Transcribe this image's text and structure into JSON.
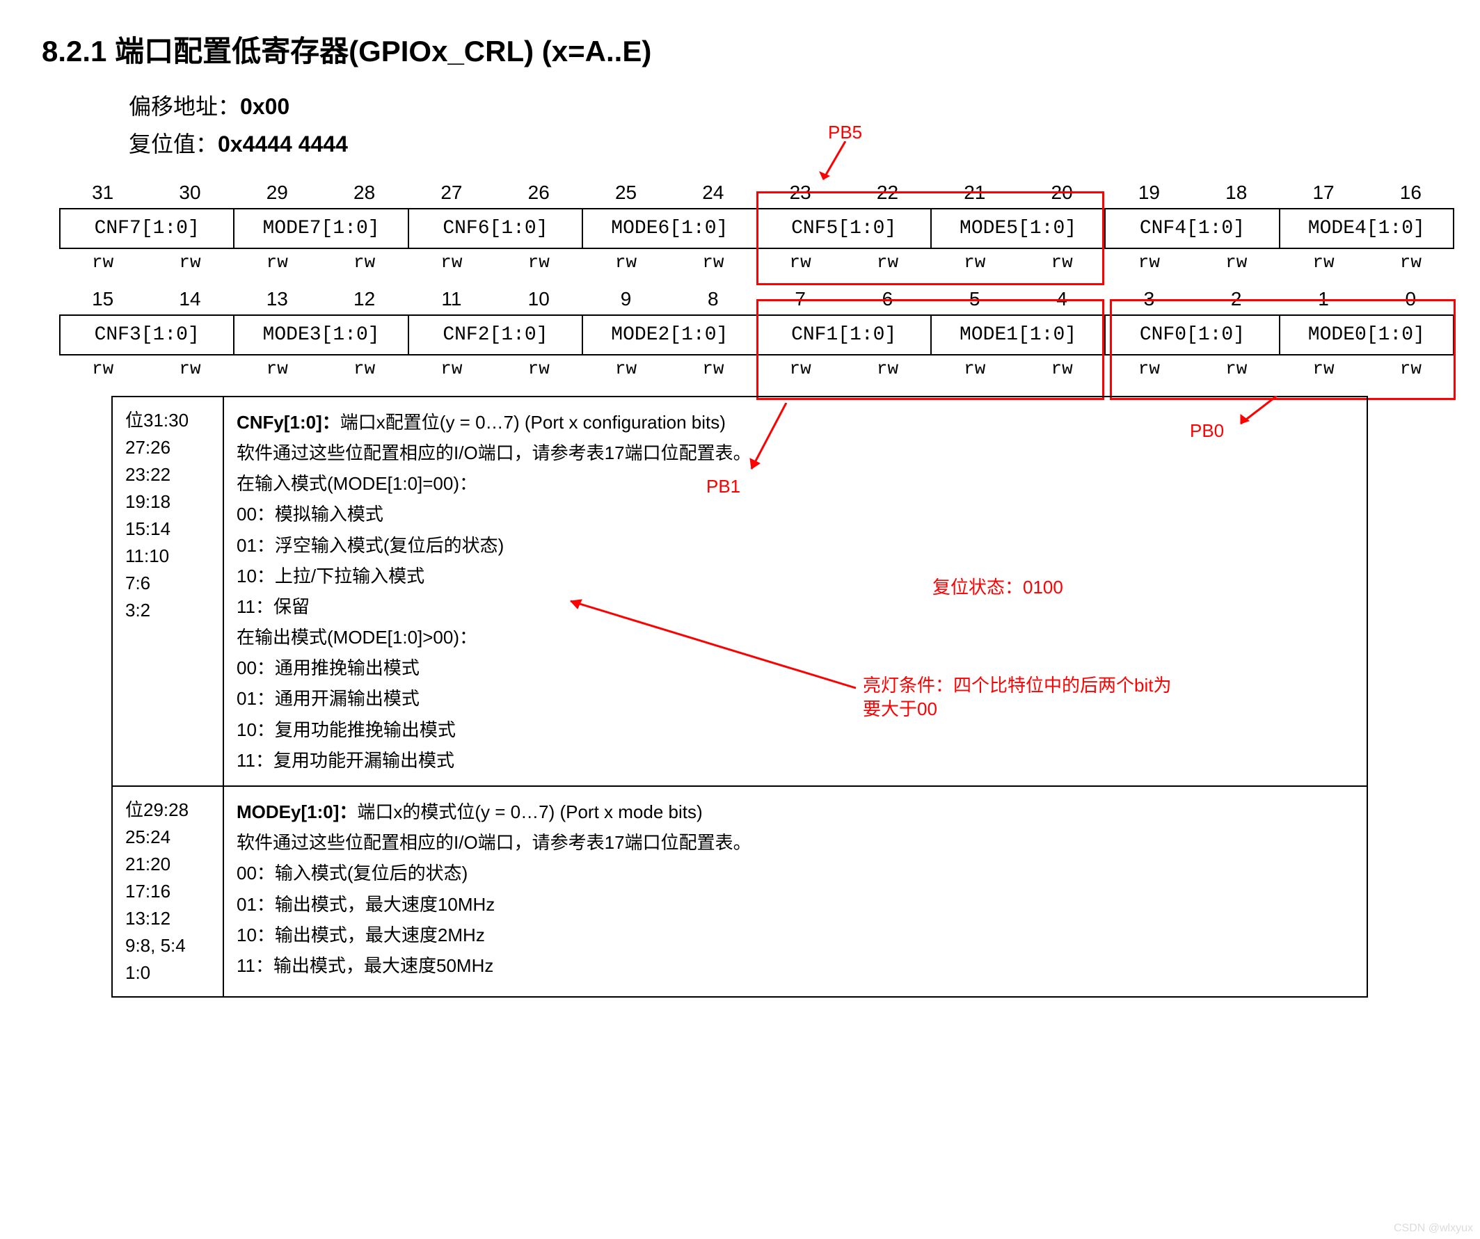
{
  "header": "8.2.1    端口配置低寄存器(GPIOx_CRL) (x=A..E)",
  "meta": {
    "offset_label": "偏移地址：",
    "offset_val": "0x00",
    "reset_label": "复位值：",
    "reset_val": "0x4444 4444"
  },
  "bits_high": [
    "31",
    "30",
    "29",
    "28",
    "27",
    "26",
    "25",
    "24",
    "23",
    "22",
    "21",
    "20",
    "19",
    "18",
    "17",
    "16"
  ],
  "fields_high": [
    "CNF7[1:0]",
    "MODE7[1:0]",
    "CNF6[1:0]",
    "MODE6[1:0]",
    "CNF5[1:0]",
    "MODE5[1:0]",
    "CNF4[1:0]",
    "MODE4[1:0]"
  ],
  "rw_high": [
    "rw",
    "rw",
    "rw",
    "rw",
    "rw",
    "rw",
    "rw",
    "rw",
    "rw",
    "rw",
    "rw",
    "rw",
    "rw",
    "rw",
    "rw",
    "rw"
  ],
  "bits_low": [
    "15",
    "14",
    "13",
    "12",
    "11",
    "10",
    "9",
    "8",
    "7",
    "6",
    "5",
    "4",
    "3",
    "2",
    "1",
    "0"
  ],
  "fields_low": [
    "CNF3[1:0]",
    "MODE3[1:0]",
    "CNF2[1:0]",
    "MODE2[1:0]",
    "CNF1[1:0]",
    "MODE1[1:0]",
    "CNF0[1:0]",
    "MODE0[1:0]"
  ],
  "rw_low": [
    "rw",
    "rw",
    "rw",
    "rw",
    "rw",
    "rw",
    "rw",
    "rw",
    "rw",
    "rw",
    "rw",
    "rw",
    "rw",
    "rw",
    "rw",
    "rw"
  ],
  "anno": {
    "pb5": "PB5",
    "pb1": "PB1",
    "pb0": "PB0",
    "reset_state": "复位状态：0100",
    "light_cond": "亮灯条件：四个比特位中的后两个bit为\n要大于00"
  },
  "cnfy": {
    "bits": "位31:30\n27:26\n23:22\n19:18\n15:14\n11:10\n7:6\n3:2",
    "head": "CNFy[1:0]：",
    "head2": "端口x配置位(y = 0…7) (Port x configuration bits)",
    "l1": "软件通过这些位配置相应的I/O端口，请参考表17端口位配置表。",
    "l2": "在输入模式(MODE[1:0]=00)：",
    "l3": "00：模拟输入模式",
    "l4": "01：浮空输入模式(复位后的状态)",
    "l5": "10：上拉/下拉输入模式",
    "l6": "11：保留",
    "l7": "在输出模式(MODE[1:0]>00)：",
    "l8": "00：通用推挽输出模式",
    "l9": "01：通用开漏输出模式",
    "l10": "10：复用功能推挽输出模式",
    "l11": "11：复用功能开漏输出模式"
  },
  "modey": {
    "bits": "位29:28\n25:24\n21:20\n17:16\n13:12\n9:8, 5:4\n1:0",
    "head": "MODEy[1:0]：",
    "head2": "端口x的模式位(y = 0…7) (Port x mode bits)",
    "l1": "软件通过这些位配置相应的I/O端口，请参考表17端口位配置表。",
    "l2": "00：输入模式(复位后的状态)",
    "l3": "01：输出模式，最大速度10MHz",
    "l4": "10：输出模式，最大速度2MHz",
    "l5": "11：输出模式，最大速度50MHz"
  },
  "watermark": "CSDN @wlxyux"
}
